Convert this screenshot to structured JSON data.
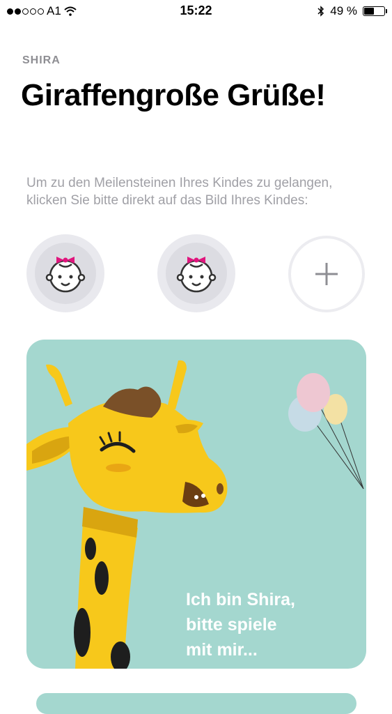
{
  "status_bar": {
    "carrier": "A1",
    "time": "15:22",
    "battery": "49 %",
    "battery_level": 0.49,
    "icons": [
      "signal-dots-icon",
      "wifi-icon",
      "bluetooth-icon",
      "battery-icon"
    ]
  },
  "header": {
    "eyebrow": "SHIRA",
    "title": "Giraffengroße Grüße!"
  },
  "instructions": "Um zu den Meilensteinen Ihres Kindes zu gelangen, klicken Sie bitte direkt auf das Bild Ihres Kindes:",
  "children": [
    {
      "icon": "baby-girl-face-icon"
    },
    {
      "icon": "baby-girl-face-icon"
    }
  ],
  "add_child": {
    "icon": "plus-icon"
  },
  "card": {
    "lines": [
      "Ich bin Shira,",
      "bitte spiele",
      "mit mir..."
    ],
    "illustration": "giraffe-illustration",
    "balloons": "balloons-icon"
  },
  "colors": {
    "accent_card": "#a4d7cf",
    "secondary_text": "#8e8e93",
    "bow": "#e0157d",
    "giraffe": "#f7c81b"
  }
}
